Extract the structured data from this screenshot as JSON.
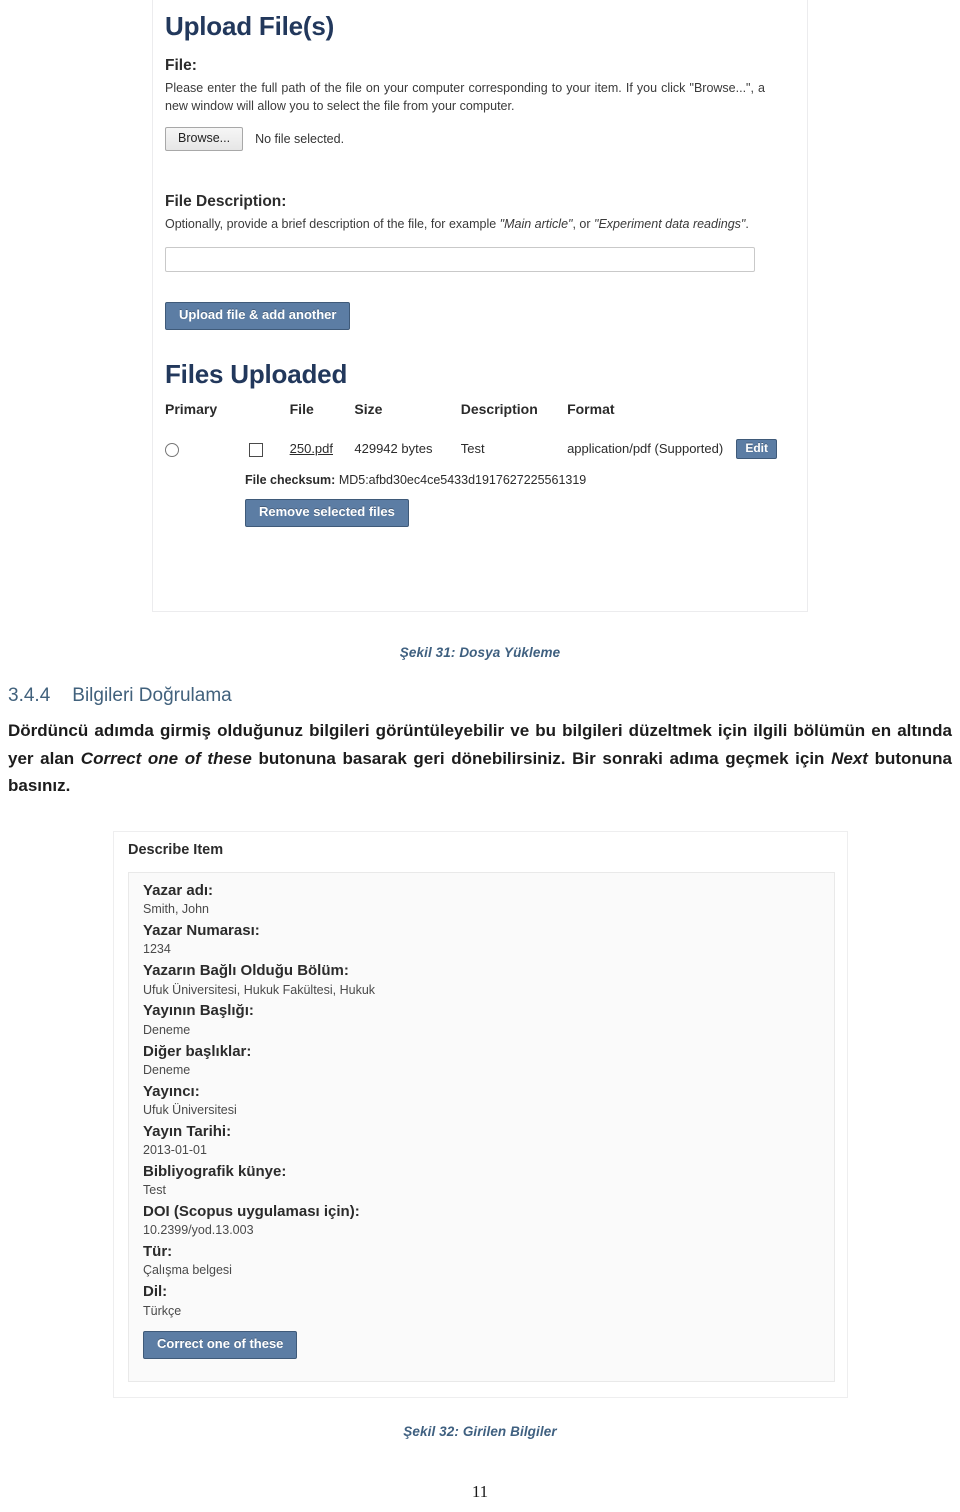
{
  "figure1": {
    "title": "Upload File(s)",
    "file_section": {
      "heading": "File:",
      "instructions": "Please enter the full path of the file on your computer corresponding to your item. If you click \"Browse...\", a new window will allow you to select the file from your computer.",
      "browse_button": "Browse...",
      "no_file_text": "No file selected."
    },
    "description_section": {
      "heading": "File Description:",
      "instructions_pre": "Optionally, provide a brief description of the file, for example ",
      "example_1": "\"Main article\"",
      "instructions_mid": ", or ",
      "example_2": "\"Experiment data readings\"",
      "instructions_post": ".",
      "input_value": "",
      "upload_button": "Upload file & add another"
    },
    "files_uploaded": {
      "heading": "Files Uploaded",
      "columns": [
        "Primary",
        "File",
        "Size",
        "Description",
        "Format"
      ],
      "rows": [
        {
          "file": "250.pdf",
          "size": "429942 bytes",
          "description": "Test",
          "format": "application/pdf (Supported)",
          "edit_button": "Edit"
        }
      ],
      "checksum_label": "File checksum:",
      "checksum_value": "MD5:afbd30ec4ce5433d1917627225561319",
      "remove_button": "Remove selected files"
    },
    "caption": "Şekil 31: Dosya Yükleme"
  },
  "section": {
    "number": "3.4.4",
    "title": "Bilgileri Doğrulama",
    "paragraph_part1": "Dördüncü adımda girmiş olduğunuz bilgileri görüntüleyebilir ve bu bilgileri düzeltmek için ilgili bölümün en altında yer alan ",
    "paragraph_italic1": "Correct one of these",
    "paragraph_part2": " butonuna basarak geri dönebilirsiniz. Bir sonraki adıma geçmek için ",
    "paragraph_italic2": "Next",
    "paragraph_part3": " butonuna basınız."
  },
  "figure2": {
    "title": "Describe Item",
    "fields": [
      {
        "label": "Yazar adı:",
        "value": "Smith, John"
      },
      {
        "label": "Yazar Numarası:",
        "value": "1234"
      },
      {
        "label": "Yazarın Bağlı Olduğu Bölüm:",
        "value": "Ufuk Üniversitesi, Hukuk Fakültesi, Hukuk"
      },
      {
        "label": "Yayının Başlığı:",
        "value": "Deneme"
      },
      {
        "label": "Diğer başlıklar:",
        "value": "Deneme"
      },
      {
        "label": "Yayıncı:",
        "value": "Ufuk Üniversitesi"
      },
      {
        "label": "Yayın Tarihi:",
        "value": "2013-01-01"
      },
      {
        "label": "Bibliyografik künye:",
        "value": "Test"
      },
      {
        "label": "DOI (Scopus uygulaması için):",
        "value": "10.2399/yod.13.003"
      },
      {
        "label": "Tür:",
        "value": "Çalışma belgesi"
      },
      {
        "label": "Dil:",
        "value": "Türkçe"
      }
    ],
    "correct_button": "Correct one of these",
    "caption": "Şekil 32: Girilen Bilgiler"
  },
  "page_number": "11",
  "colors": {
    "heading_navy": "#22385c",
    "section_heading_blue": "#41617c",
    "caption_blue": "#3f6080",
    "button_blue": "#5c7da4",
    "button_border": "#3f5a79"
  }
}
